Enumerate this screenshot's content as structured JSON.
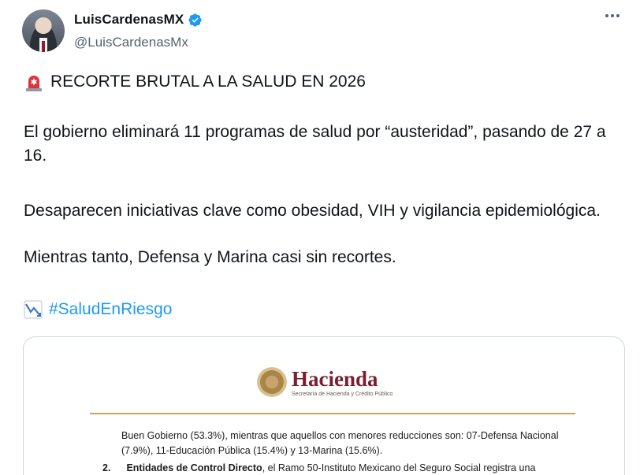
{
  "author": {
    "display_name": "LuisCardenasMX",
    "handle": "@LuisCardenasMx",
    "verified": true
  },
  "menu": {
    "icon": "more-dots-icon"
  },
  "tweet": {
    "line1": "RECORTE BRUTAL A LA SALUD EN 2026",
    "line1_emoji": "siren-icon",
    "para1": "El gobierno eliminará 11 programas de salud por “austeridad”, pasando de 27 a 16.",
    "para2": "Desaparecen iniciativas clave como obesidad, VIH y vigilancia epidemiológica.",
    "para3": "Mientras tanto, Defensa y Marina casi sin recortes.",
    "hashtag": "#SaludEnRiesgo",
    "hashtag_emoji": "chart-decreasing-icon"
  },
  "media": {
    "brand": "Hacienda",
    "brand_sub": "Secretaría de Hacienda y Crédito Público",
    "doc_line1": "Buen Gobierno (53.3%), mientras que aquellos con menores reducciones son: 07-Defensa Nacional",
    "doc_line2": "(7.9%), 11-Educación Pública (15.4%) y 13-Marina (15.6%).",
    "doc_item_number": "2.",
    "doc_item_bold": "Entidades de Control Directo",
    "doc_item_rest": ", el Ramo 50-Instituto Mexicano del Seguro Social registra una"
  },
  "colors": {
    "text": "#0f1419",
    "secondary": "#536471",
    "link": "#1d9bf0",
    "hacienda": "#7b1f2e",
    "gold": "#c6a464"
  }
}
